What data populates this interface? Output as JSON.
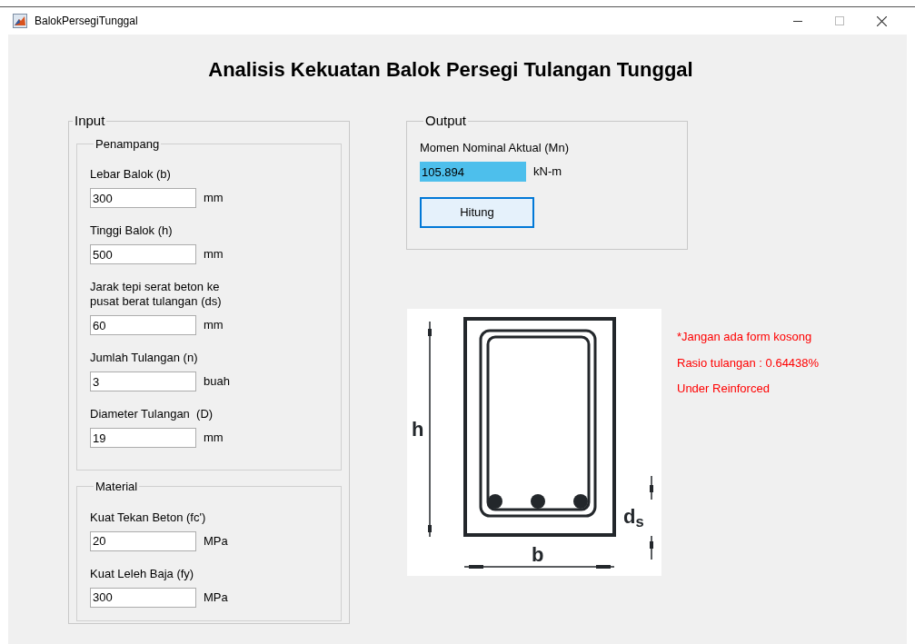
{
  "window": {
    "title": "BalokPersegiTunggal"
  },
  "heading": "Analisis Kekuatan Balok Persegi Tulangan Tunggal",
  "input": {
    "title": "Input",
    "groups": [
      {
        "title": "Penampang",
        "fields": [
          {
            "label": "Lebar Balok (b)",
            "value": "300",
            "unit": "mm"
          },
          {
            "label": "Tinggi Balok (h)",
            "value": "500",
            "unit": "mm"
          },
          {
            "label": "Jarak tepi serat beton ke\npusat berat tulangan (ds)",
            "value": "60",
            "unit": "mm"
          },
          {
            "label": "Jumlah Tulangan (n)",
            "value": "3",
            "unit": "buah"
          },
          {
            "label": "Diameter Tulangan  (D)",
            "value": "19",
            "unit": "mm"
          }
        ]
      },
      {
        "title": "Material",
        "fields": [
          {
            "label": "Kuat Tekan Beton (fc')",
            "value": "20",
            "unit": "MPa"
          },
          {
            "label": "Kuat Leleh Baja (fy)",
            "value": "300",
            "unit": "MPa"
          }
        ]
      }
    ]
  },
  "output": {
    "title": "Output",
    "label": "Momen Nominal Aktual (Mn)",
    "value": "105.894",
    "unit": "kN-m",
    "button": "Hitung"
  },
  "diagram": {
    "height_label": "h",
    "width_label": "b",
    "cover_label": "d$_{s}$"
  },
  "notes": [
    "*Jangan ada form kosong",
    "Rasio tulangan : 0.64438%",
    "Under Reinforced"
  ]
}
